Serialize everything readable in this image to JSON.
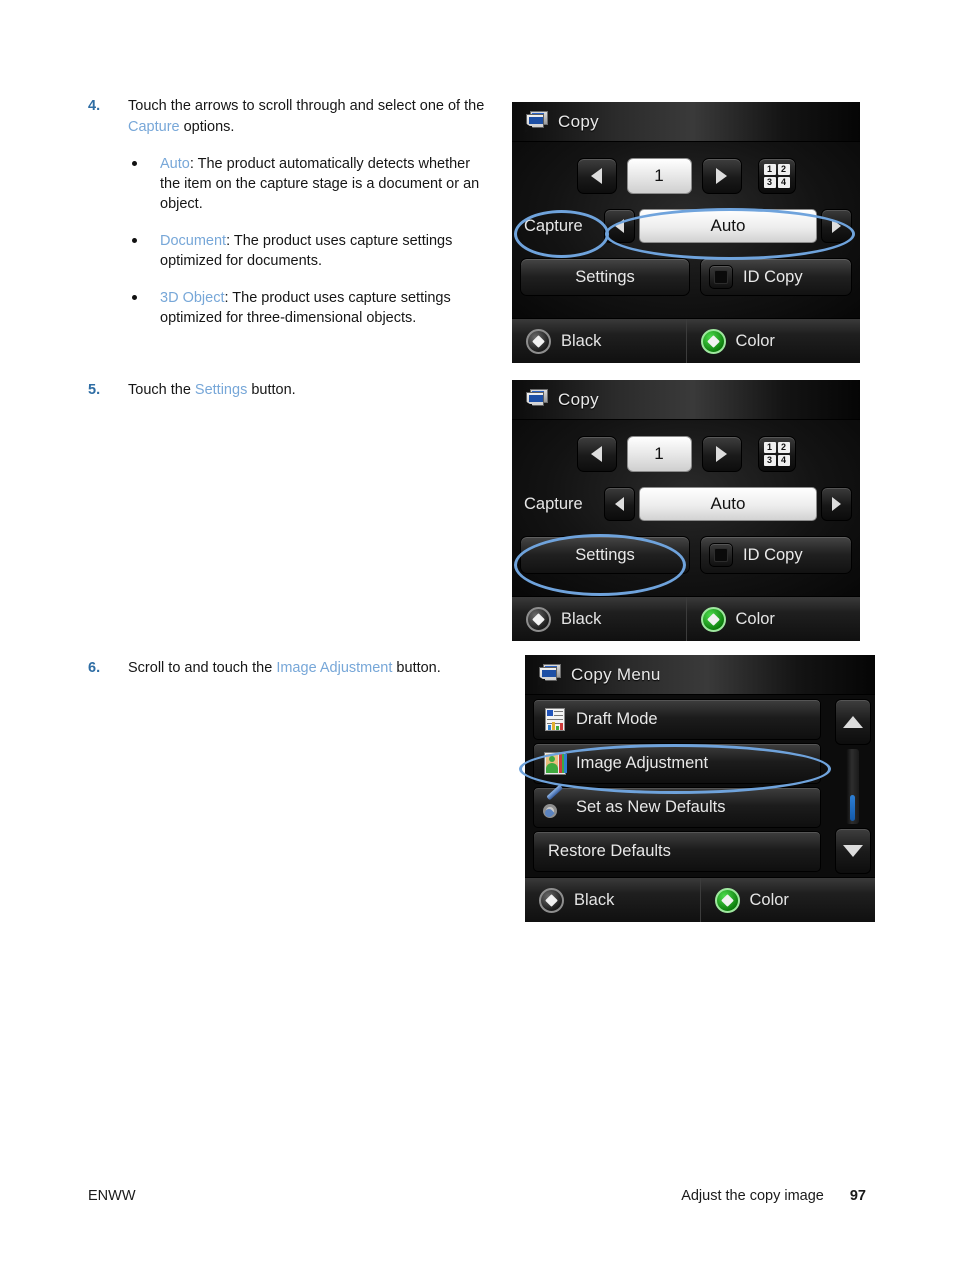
{
  "steps": [
    {
      "number": "4.",
      "text_before": "Touch the arrows to scroll through and select one of the ",
      "link": "Capture",
      "text_after": " options.",
      "bullets": [
        {
          "link": "Auto",
          "text": ": The product automatically detects whether the item on the capture stage is a document or an object."
        },
        {
          "link": "Document",
          "text": ": The product uses capture settings optimized for documents."
        },
        {
          "link": "3D Object",
          "text": ": The product uses capture settings optimized for three-dimensional objects."
        }
      ]
    },
    {
      "number": "5.",
      "text_before": "Touch the ",
      "link": "Settings",
      "text_after": " button."
    },
    {
      "number": "6.",
      "text_before": "Scroll to and touch the ",
      "link": "Image Adjustment",
      "text_after": " button."
    }
  ],
  "panels": [
    {
      "id": "copy-screen-capture",
      "title": "Copy",
      "copy_count": "1",
      "numpad_digits": [
        "1",
        "2",
        "3",
        "4"
      ],
      "capture_label": "Capture",
      "capture_value": "Auto",
      "settings_label": "Settings",
      "id_copy_label": "ID Copy",
      "black_label": "Black",
      "color_label": "Color"
    },
    {
      "id": "copy-screen-settings",
      "title": "Copy",
      "copy_count": "1",
      "numpad_digits": [
        "1",
        "2",
        "3",
        "4"
      ],
      "capture_label": "Capture",
      "capture_value": "Auto",
      "settings_label": "Settings",
      "id_copy_label": "ID Copy",
      "black_label": "Black",
      "color_label": "Color"
    },
    {
      "id": "copy-menu-screen",
      "title": "Copy Menu",
      "menu_items": [
        {
          "label": "Draft Mode",
          "icon": "draft-mode-icon"
        },
        {
          "label": "Image Adjustment",
          "icon": "image-adjustment-icon"
        },
        {
          "label": "Set as New Defaults",
          "icon": "set-defaults-icon"
        },
        {
          "label": "Restore Defaults",
          "icon": "none"
        }
      ],
      "black_label": "Black",
      "color_label": "Color"
    }
  ],
  "footer": {
    "left": "ENWW",
    "section": "Adjust the copy image",
    "page": "97"
  },
  "colors": {
    "link_blue": "#77a7d8",
    "step_number_blue": "#2e6da4",
    "highlight_ellipse": "#6fa3dc",
    "color_button_green": "#2db52d"
  }
}
